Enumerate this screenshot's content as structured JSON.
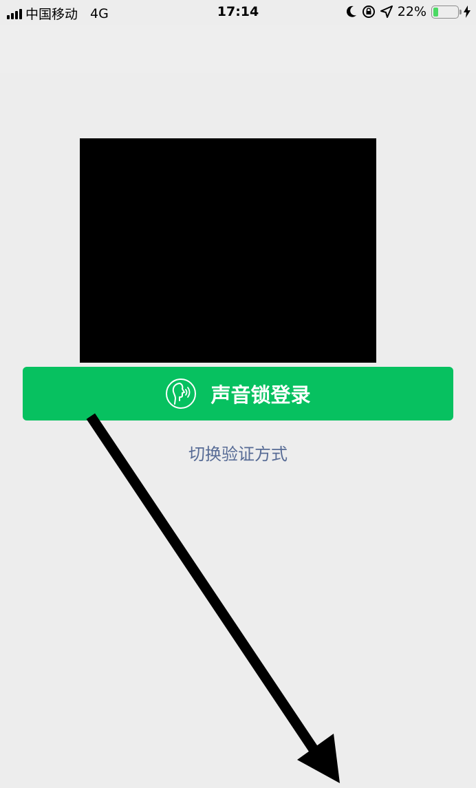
{
  "status_bar": {
    "carrier": "中国移动",
    "network": "4G",
    "time": "17:14",
    "battery_percent": "22%",
    "battery_level": 0.22,
    "battery_color": "#4cd964",
    "icons": [
      "signal-icon",
      "moon-icon",
      "orientation-lock-icon",
      "location-arrow-icon",
      "battery-icon",
      "charging-bolt-icon"
    ]
  },
  "login": {
    "voice_button_label": "声音锁登录",
    "voice_icon": "voice-face-icon",
    "switch_method_label": "切换验证方式"
  },
  "colors": {
    "accent": "#07c160",
    "link": "#576b95",
    "background": "#ededed"
  }
}
